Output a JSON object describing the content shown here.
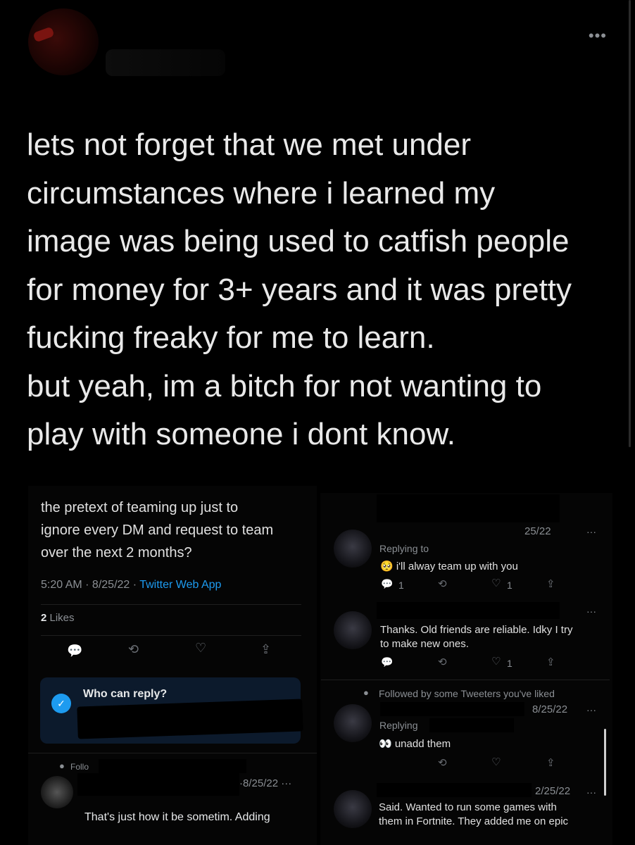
{
  "header": {
    "more_label": "•••"
  },
  "main_tweet": {
    "text": "lets not forget that we met under\ncircumstances where i learned my\nimage was being used to catfish people\nfor money for 3+ years and it was pretty\nfucking freaky for me to learn.\nbut yeah, im a bitch for not wanting to\nplay with someone i dont know."
  },
  "left_screenshot": {
    "tweet_text": "the pretext of teaming up just to\nignore every DM and request to team\nover the next 2 months?",
    "time": "5:20 AM · 8/25/22 · ",
    "source": "Twitter Web App",
    "likes_count": "2",
    "likes_label": " Likes",
    "actions": {
      "reply": "💬",
      "retweet": "⟲",
      "like": "♡",
      "share": "⇪"
    },
    "who_can_reply": "Who can reply?",
    "follow_label": "Follo",
    "followed_date": "·8/25/22",
    "more": "···",
    "reply_text": "That's just how it be sometim",
    "reply_text_tail": ". Adding"
  },
  "right_screenshot": {
    "tweet1": {
      "date": "25/22",
      "more": "···",
      "replying": "Replying to",
      "text": "🥺 i'll alway team up with you",
      "reply_count": "1",
      "like_count": "1"
    },
    "tweet2": {
      "more": "···",
      "text": "Thanks. Old friends are reliable. Idky I try\nto make new ones.",
      "like_count": "1"
    },
    "tweet3": {
      "followed_by": "Followed by some Tweeters you've liked",
      "date": "8/25/22",
      "more": "···",
      "replying": "Replying",
      "text": "👀 unadd them"
    },
    "tweet4": {
      "date": "2/25/22",
      "more": "···",
      "text": "Said. Wanted to run some games with\nthem in Fortnite. They added me on epic"
    },
    "actions": {
      "reply": "💬",
      "retweet": "⟲",
      "like": "♡",
      "share": "⇪"
    }
  }
}
